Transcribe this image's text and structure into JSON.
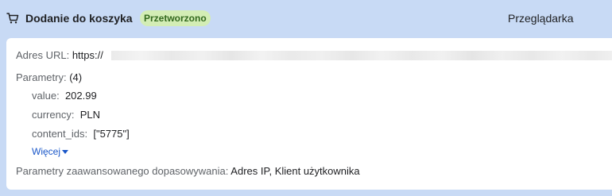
{
  "header": {
    "icon": "cart-icon",
    "title": "Dodanie do koszyka",
    "status": "Przetworzono",
    "source": "Przeglądarka"
  },
  "details": {
    "url_label": "Adres URL:",
    "url_value": "https://",
    "params_label": "Parametry:",
    "params_count": "(4)",
    "params": [
      {
        "name": "value:",
        "value": "202.99"
      },
      {
        "name": "currency:",
        "value": "PLN"
      },
      {
        "name": "content_ids:",
        "value": "[\"5775\"]"
      }
    ],
    "more_label": "Więcej",
    "advanced_label": "Parametry zaawansowanego dopasowywania:",
    "advanced_value": "Adres IP, Klient użytkownika"
  },
  "colors": {
    "header_bg": "#c8daf5",
    "badge_bg": "#d3edb5",
    "badge_text": "#33691e",
    "link": "#1a57c9"
  }
}
